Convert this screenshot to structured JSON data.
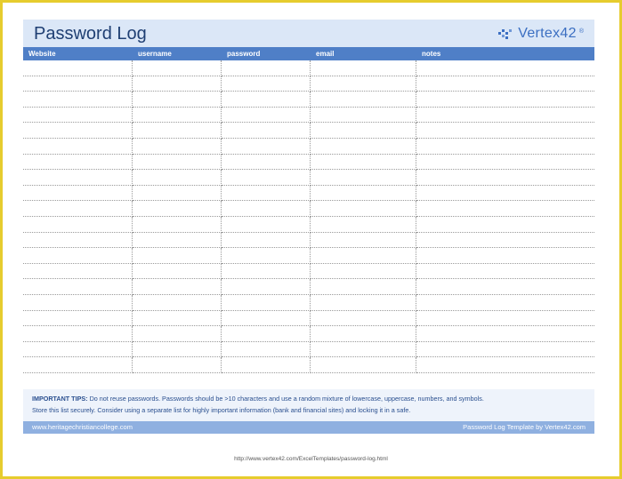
{
  "title": "Password Log",
  "logo": {
    "text": "Vertex42",
    "superscript": "®"
  },
  "columns": [
    "Website",
    "username",
    "password",
    "email",
    "notes"
  ],
  "row_count": 20,
  "tips": {
    "label": "IMPORTANT TIPS:",
    "line1": "Do not reuse passwords. Passwords should be >10 characters and use a random mixture of lowercase, uppercase, numbers, and symbols.",
    "line2": "Store this list securely. Consider using a separate list for highly important information (bank and financial sites) and locking it in a safe."
  },
  "footer": {
    "left": "www.heritagechristiancollege.com",
    "right": "Password Log Template by Vertex42.com"
  },
  "url": "http://www.vertex42.com/ExcelTemplates/password-log.html",
  "colors": {
    "frame": "#e6cc2e",
    "title_bar": "#dbe7f7",
    "header": "#4f7fc7",
    "footer": "#8fb0e0"
  }
}
